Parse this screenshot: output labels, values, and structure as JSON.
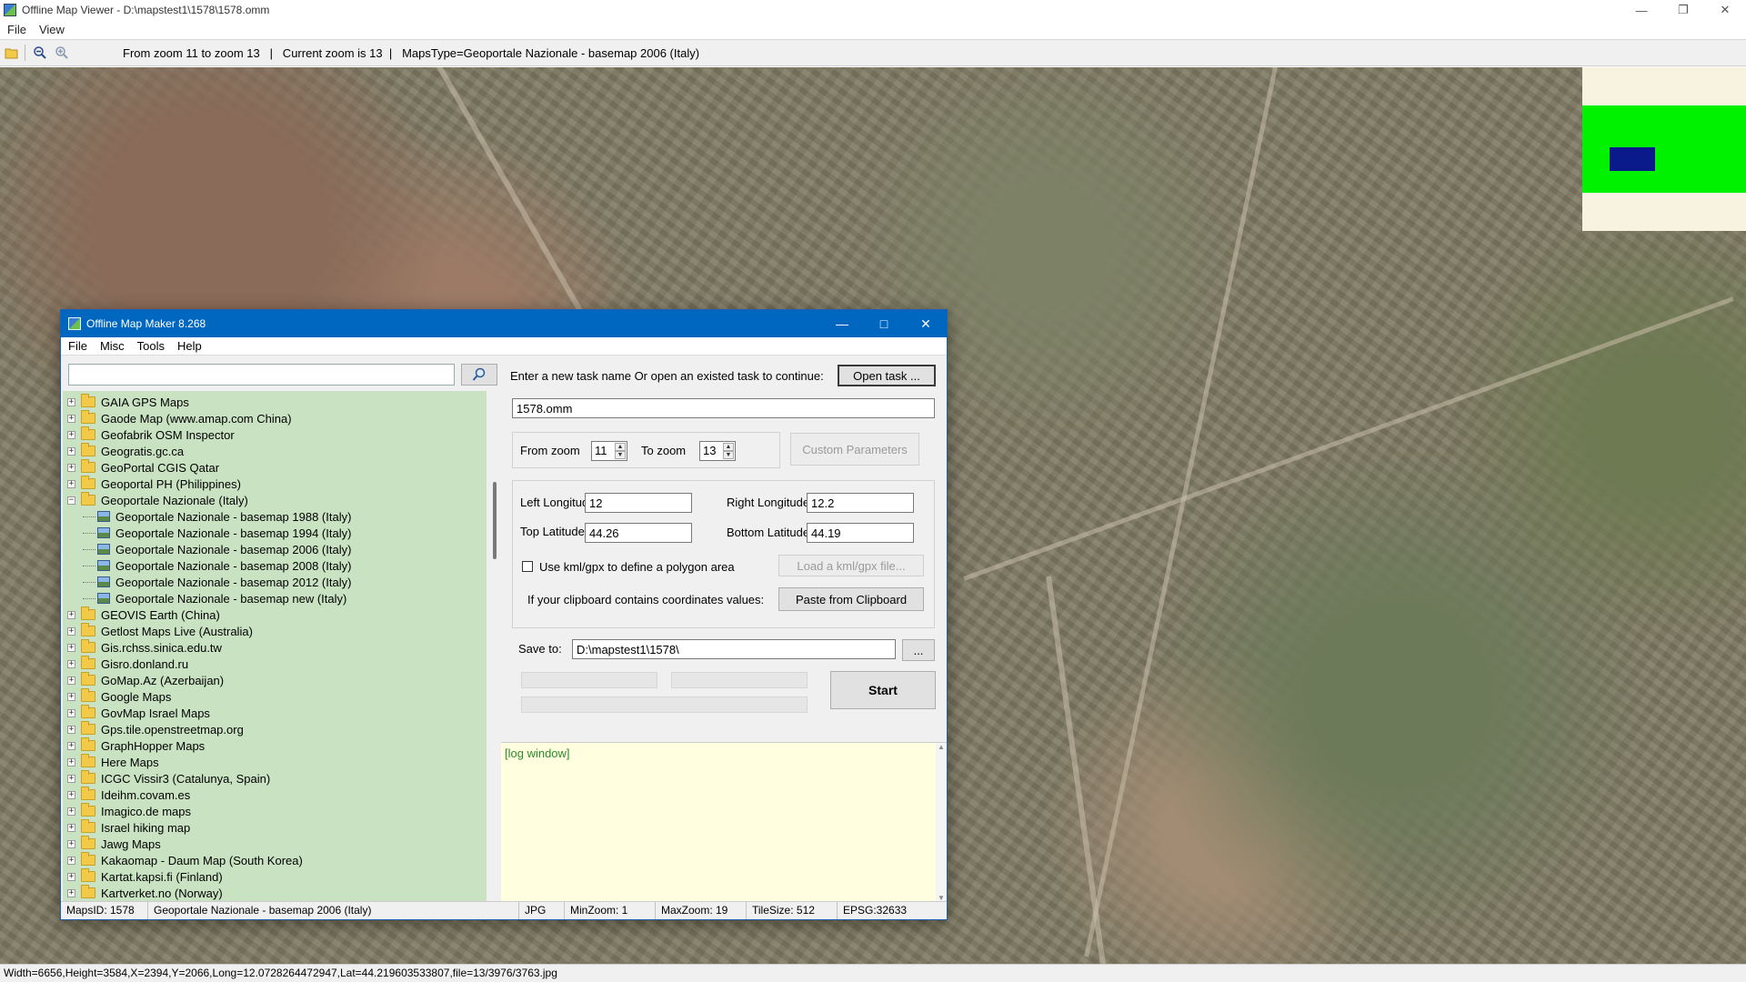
{
  "viewer": {
    "title": "Offline Map Viewer - D:\\mapstest1\\1578\\1578.omm",
    "menu": [
      "File",
      "View"
    ],
    "toolbar_info": "From zoom 11 to zoom 13   |   Current zoom is 13  |   MapsType=Geoportale Nazionale - basemap 2006 (Italy)",
    "status": "Width=6656,Height=3584,X=2394,Y=2066,Long=12.0728264472947,Lat=44.219603533807,file=13/3976/3763.jpg",
    "toolbar_icons": [
      "open-folder-icon",
      "zoom-out-icon",
      "zoom-in-icon"
    ],
    "minimap_colors": {
      "background": "#f8f2e0",
      "area": "#00f200",
      "view": "#0b1a8a"
    }
  },
  "maker": {
    "title": "Offline Map Maker 8.268",
    "menu": [
      "File",
      "Misc",
      "Tools",
      "Help"
    ],
    "search": {
      "value": "",
      "placeholder": ""
    },
    "tree": [
      {
        "label": "GAIA GPS Maps",
        "type": "folder",
        "expanded": false
      },
      {
        "label": "Gaode Map (www.amap.com China)",
        "type": "folder",
        "expanded": false
      },
      {
        "label": "Geofabrik OSM Inspector",
        "type": "folder",
        "expanded": false
      },
      {
        "label": "Geogratis.gc.ca",
        "type": "folder",
        "expanded": false
      },
      {
        "label": "GeoPortal CGIS Qatar",
        "type": "folder",
        "expanded": false
      },
      {
        "label": "Geoportal PH (Philippines)",
        "type": "folder",
        "expanded": false
      },
      {
        "label": "Geoportale Nazionale (Italy)",
        "type": "folder",
        "expanded": true
      },
      {
        "label": "Geoportale Nazionale - basemap 1988 (Italy)",
        "type": "map"
      },
      {
        "label": "Geoportale Nazionale - basemap 1994 (Italy)",
        "type": "map"
      },
      {
        "label": "Geoportale Nazionale - basemap 2006 (Italy)",
        "type": "map"
      },
      {
        "label": "Geoportale Nazionale - basemap 2008 (Italy)",
        "type": "map"
      },
      {
        "label": "Geoportale Nazionale - basemap 2012 (Italy)",
        "type": "map"
      },
      {
        "label": "Geoportale Nazionale - basemap new (Italy)",
        "type": "map"
      },
      {
        "label": "GEOVIS Earth (China)",
        "type": "folder",
        "expanded": false
      },
      {
        "label": "Getlost Maps Live (Australia)",
        "type": "folder",
        "expanded": false
      },
      {
        "label": "Gis.rchss.sinica.edu.tw",
        "type": "folder",
        "expanded": false
      },
      {
        "label": "Gisro.donland.ru",
        "type": "folder",
        "expanded": false
      },
      {
        "label": "GoMap.Az (Azerbaijan)",
        "type": "folder",
        "expanded": false
      },
      {
        "label": "Google Maps",
        "type": "folder",
        "expanded": false
      },
      {
        "label": "GovMap Israel Maps",
        "type": "folder",
        "expanded": false
      },
      {
        "label": "Gps.tile.openstreetmap.org",
        "type": "folder",
        "expanded": false
      },
      {
        "label": "GraphHopper Maps",
        "type": "folder",
        "expanded": false
      },
      {
        "label": "Here Maps",
        "type": "folder",
        "expanded": false
      },
      {
        "label": "ICGC Vissir3 (Catalunya, Spain)",
        "type": "folder",
        "expanded": false
      },
      {
        "label": "Ideihm.covam.es",
        "type": "folder",
        "expanded": false
      },
      {
        "label": "Imagico.de maps",
        "type": "folder",
        "expanded": false
      },
      {
        "label": "Israel hiking map",
        "type": "folder",
        "expanded": false
      },
      {
        "label": "Jawg Maps",
        "type": "folder",
        "expanded": false
      },
      {
        "label": "Kakaomap - Daum Map (South Korea)",
        "type": "folder",
        "expanded": false
      },
      {
        "label": "Kartat.kapsi.fi (Finland)",
        "type": "folder",
        "expanded": false
      },
      {
        "label": "Kartverket.no (Norway)",
        "type": "folder",
        "expanded": false
      }
    ],
    "task_prompt": "Enter a new task name Or open an existed task to continue:",
    "open_task_label": "Open task ...",
    "task_name": "1578.omm",
    "from_zoom_label": "From zoom",
    "from_zoom": "11",
    "to_zoom_label": "To zoom",
    "to_zoom": "13",
    "custom_params_label": "Custom Parameters",
    "left_lon_label": "Left Longitude",
    "left_lon": "12",
    "right_lon_label": "Right Longitude",
    "right_lon": "12.2",
    "top_lat_label": "Top Latitude",
    "top_lat": "44.26",
    "bottom_lat_label": "Bottom Latitude",
    "bottom_lat": "44.19",
    "kml_label": "Use kml/gpx to define a polygon area",
    "load_kml_label": "Load a kml/gpx file...",
    "clipboard_prompt": "If your clipboard contains coordinates values:",
    "paste_label": "Paste from Clipboard",
    "save_to_label": "Save to:",
    "save_to": "D:\\mapstest1\\1578\\",
    "browse_label": "...",
    "start_label": "Start",
    "log_text": "[log window]",
    "status": {
      "maps_id": "MapsID: 1578",
      "map_name": "Geoportale Nazionale - basemap 2006 (Italy)",
      "format": "JPG",
      "min_zoom": "MinZoom: 1",
      "max_zoom": "MaxZoom: 19",
      "tile_size": "TileSize: 512",
      "epsg": "EPSG:32633"
    }
  }
}
